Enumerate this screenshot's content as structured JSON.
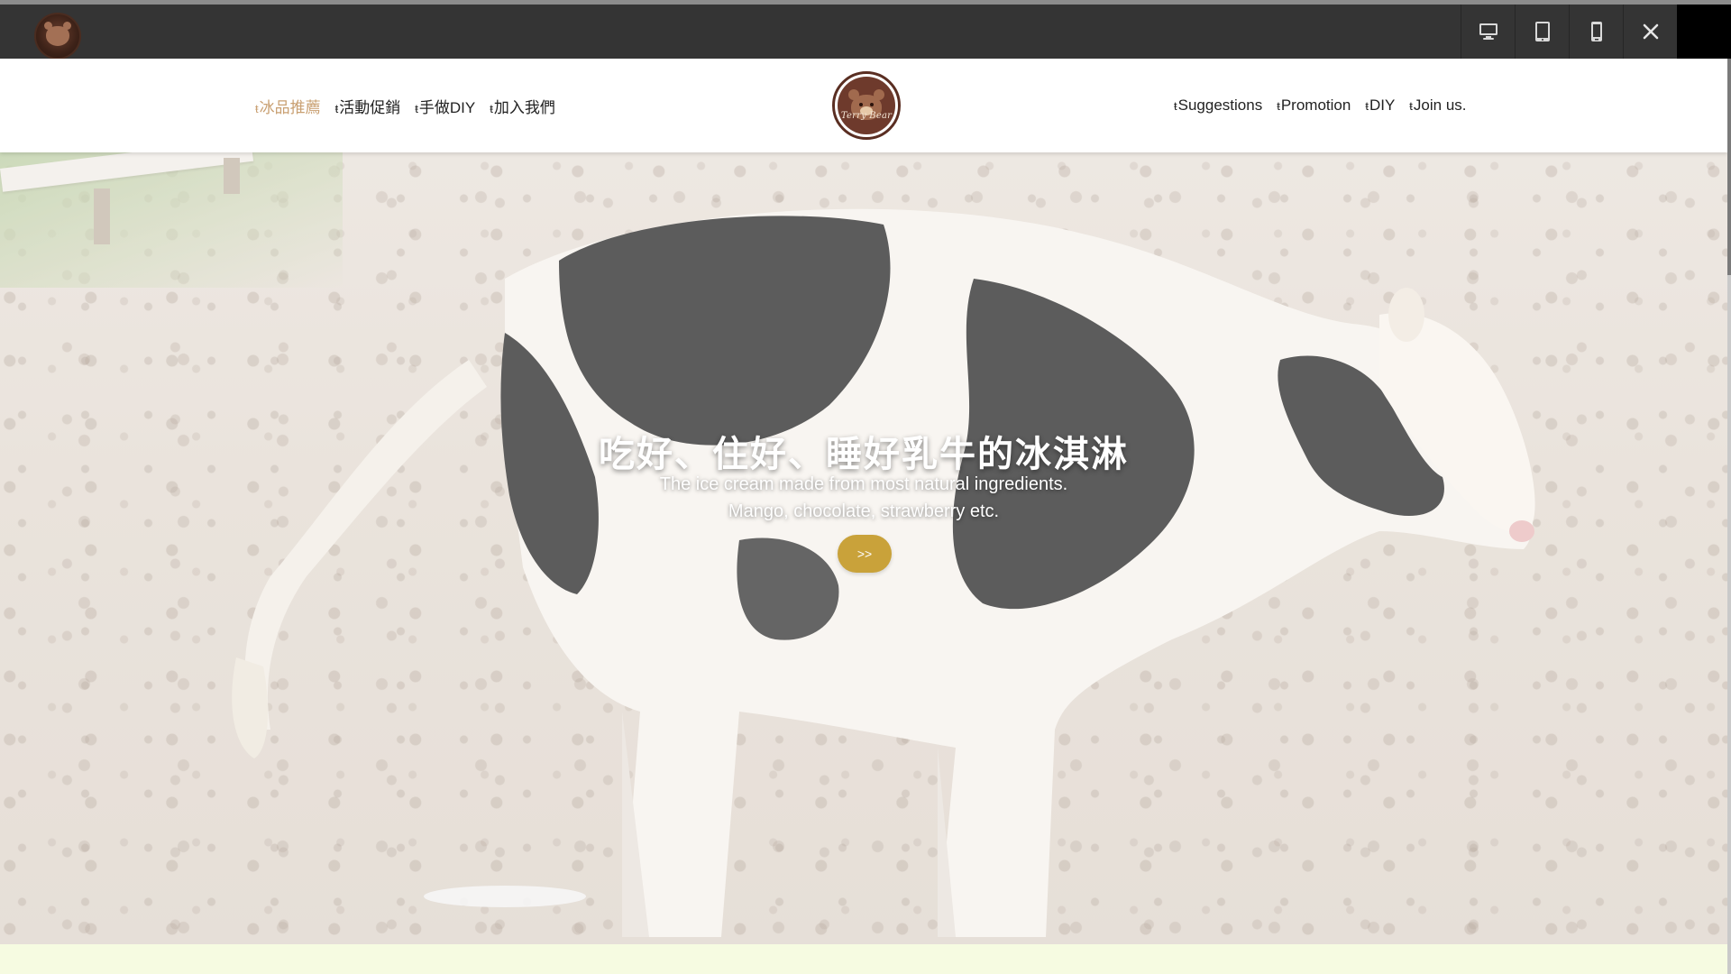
{
  "toolbar": {
    "logo_icon": "terry-bear-logo",
    "buttons": [
      {
        "name": "desktop-view",
        "icon": "monitor-icon"
      },
      {
        "name": "tablet-view",
        "icon": "tablet-icon"
      },
      {
        "name": "mobile-view",
        "icon": "phone-icon"
      },
      {
        "name": "close",
        "icon": "close-icon"
      }
    ]
  },
  "nav": {
    "glyph": "ŧ",
    "left": [
      {
        "label": "冰品推薦",
        "active": true
      },
      {
        "label": "活動促銷",
        "active": false
      },
      {
        "label": "手做DIY",
        "active": false
      },
      {
        "label": "加入我們",
        "active": false
      }
    ],
    "right": [
      {
        "label": "Suggestions"
      },
      {
        "label": "Promotion"
      },
      {
        "label": "DIY"
      },
      {
        "label": "Join us."
      }
    ],
    "logo_text": "Terry Bear"
  },
  "hero": {
    "title": "吃好、住好、睡好乳牛的冰淇淋",
    "subtitle_line1": "The ice cream made from most natural ingredients.",
    "subtitle_line2": "Mango, chocolate, strawberry etc.",
    "button_label": ">>"
  },
  "colors": {
    "toolbar_bg": "#343434",
    "nav_active": "#c9a072",
    "button_accent": "#c9a23a",
    "bottom_band": "#f6fbe1"
  }
}
